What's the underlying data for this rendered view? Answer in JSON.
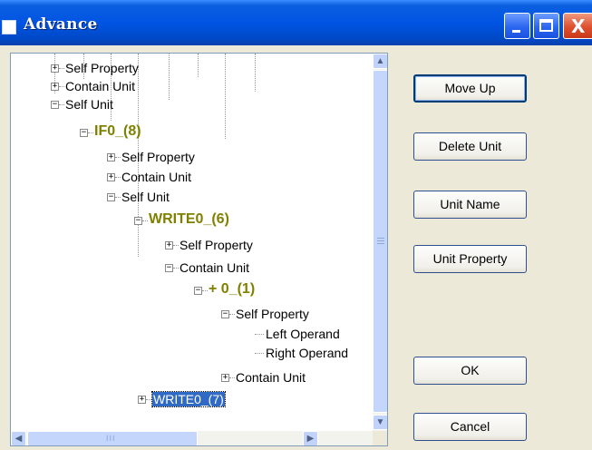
{
  "window": {
    "title": "Advance",
    "minimize_icon": "minimize-icon",
    "maximize_icon": "maximize-icon",
    "close_icon": "close-icon",
    "close_glyph": "X"
  },
  "tree": {
    "nodes": [
      {
        "label": "Self Property",
        "expander": "+",
        "kind": "prop"
      },
      {
        "label": "Contain Unit",
        "expander": "+",
        "kind": "prop"
      },
      {
        "label": "Self Unit",
        "expander": "−",
        "kind": "prop"
      },
      {
        "label": "IF0_(8)",
        "expander": "−",
        "kind": "unit"
      },
      {
        "label": "Self Property",
        "expander": "+",
        "kind": "prop"
      },
      {
        "label": "Contain Unit",
        "expander": "+",
        "kind": "prop"
      },
      {
        "label": "Self Unit",
        "expander": "−",
        "kind": "prop"
      },
      {
        "label": "WRITE0_(6)",
        "expander": "−",
        "kind": "unit"
      },
      {
        "label": "Self Property",
        "expander": "+",
        "kind": "prop"
      },
      {
        "label": "Contain Unit",
        "expander": "−",
        "kind": "prop"
      },
      {
        "label": "+ 0_(1)",
        "expander": "−",
        "kind": "unit"
      },
      {
        "label": "Self Property",
        "expander": "−",
        "kind": "prop"
      },
      {
        "label": "Left Operand",
        "expander": "",
        "kind": "leaf"
      },
      {
        "label": "Right Operand",
        "expander": "",
        "kind": "leaf"
      },
      {
        "label": "Contain Unit",
        "expander": "+",
        "kind": "prop"
      },
      {
        "label": "WRITE0_(7)",
        "expander": "+",
        "kind": "selected"
      }
    ],
    "scroll_up": "▲",
    "scroll_down": "▼",
    "scroll_left": "◀",
    "scroll_right": "▶",
    "grip": "III"
  },
  "buttons": {
    "move_up": "Move Up",
    "delete_unit": "Delete Unit",
    "unit_name": "Unit Name",
    "unit_property": "Unit Property",
    "ok": "OK",
    "cancel": "Cancel"
  },
  "colors": {
    "titlebar": "#0054e3",
    "unit_text": "#808000",
    "selection": "#316ac5",
    "dialog_bg": "#ece9d8"
  }
}
